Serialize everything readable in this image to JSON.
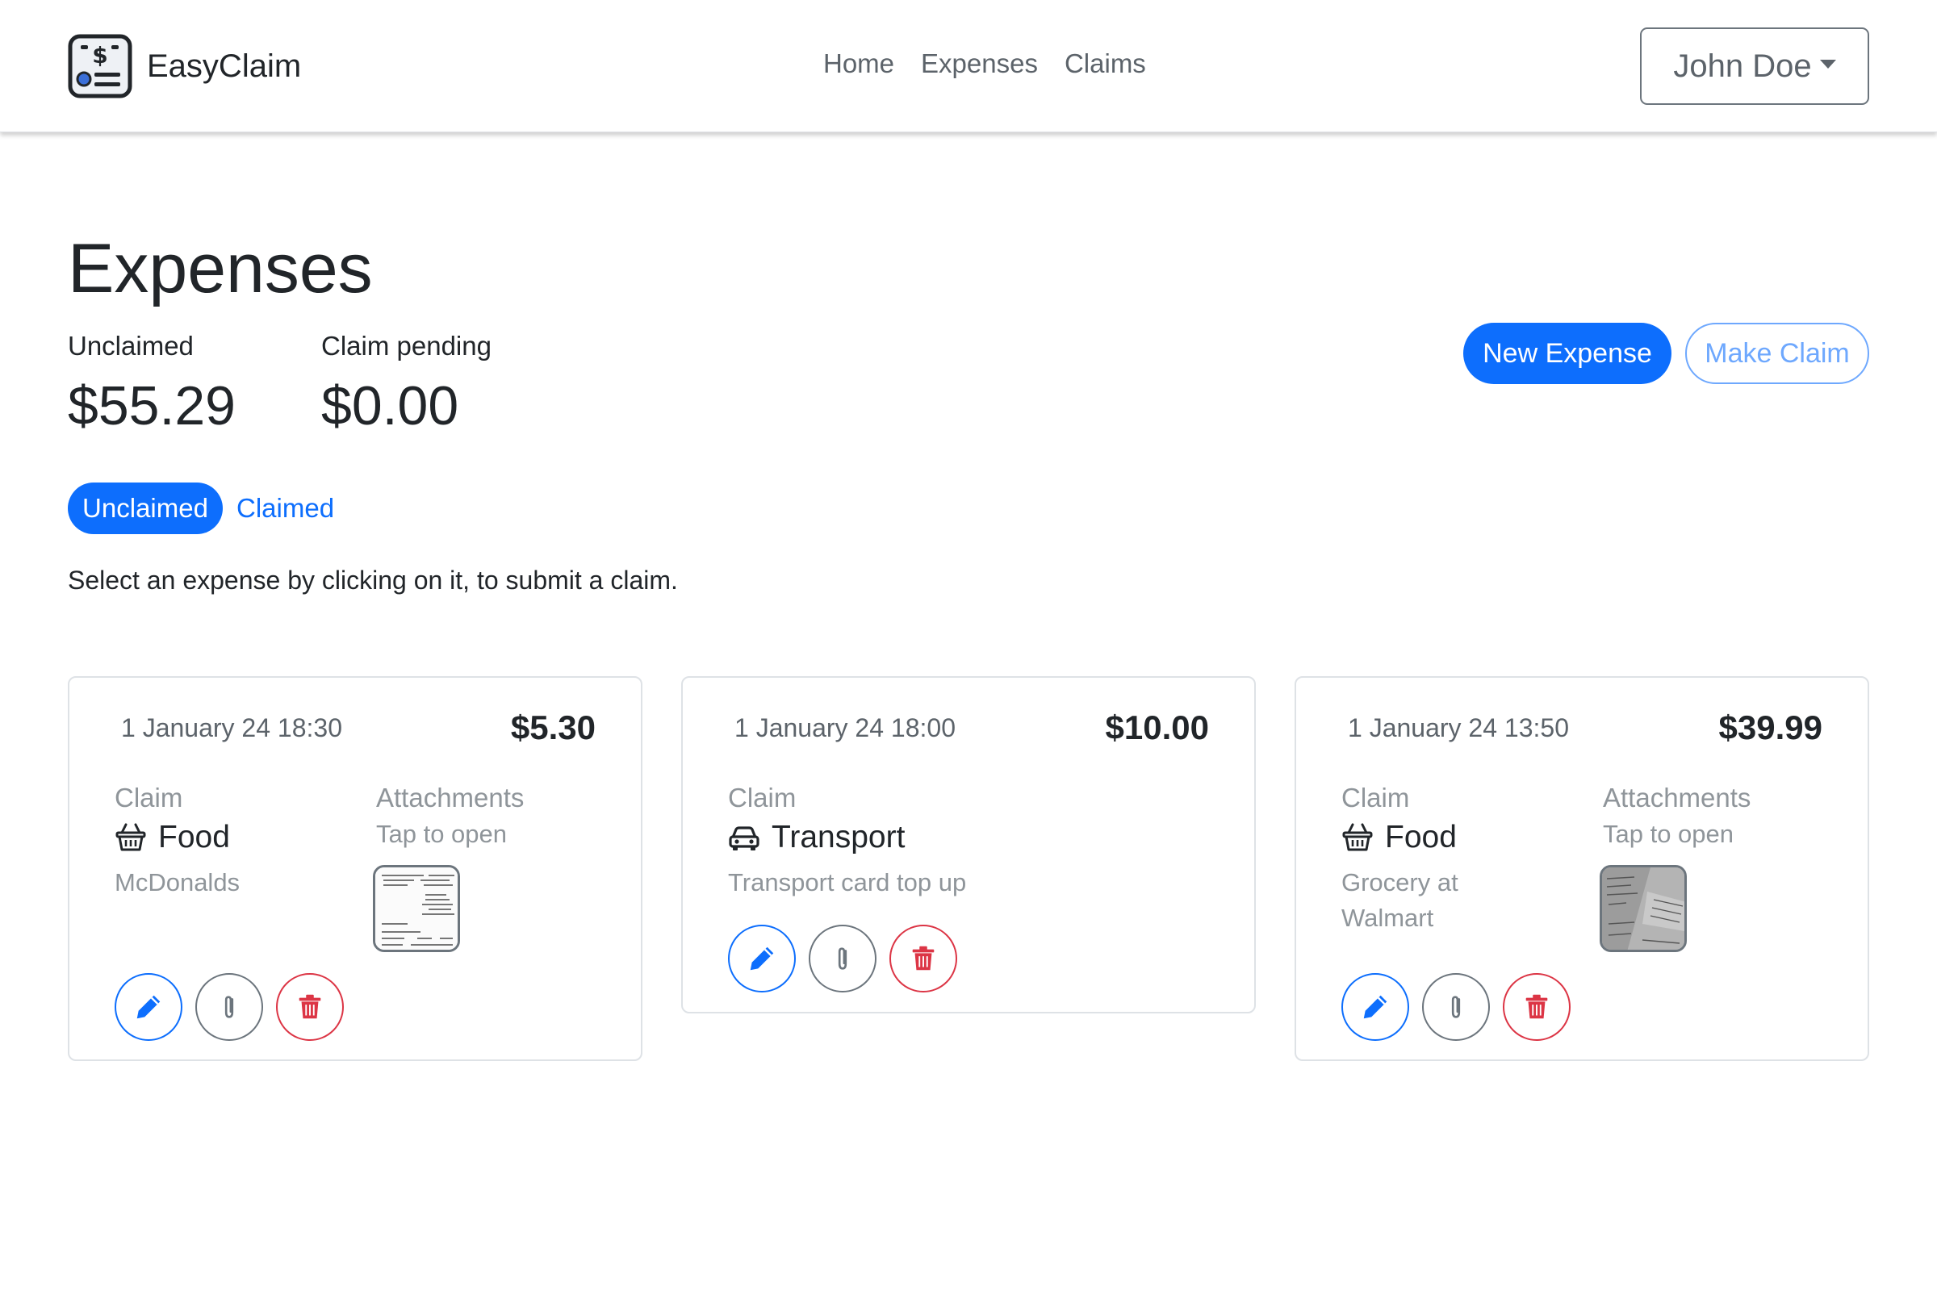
{
  "nav": {
    "brand": "EasyClaim",
    "links": [
      "Home",
      "Expenses",
      "Claims"
    ],
    "user": "John Doe"
  },
  "page": {
    "title": "Expenses",
    "unclaimed_label": "Unclaimed",
    "unclaimed_value": "$55.29",
    "pending_label": "Claim pending",
    "pending_value": "$0.00",
    "new_expense": "New Expense",
    "make_claim": "Make Claim",
    "tab_unclaimed": "Unclaimed",
    "tab_claimed": "Claimed",
    "hint": "Select an expense by clicking on it, to submit a claim."
  },
  "cards": [
    {
      "date": "1 January 24 18:30",
      "amount": "$5.30",
      "claim_label": "Claim",
      "category": "Food",
      "category_icon": "basket-icon",
      "description": "McDonalds",
      "attachments_label": "Attachments",
      "tap_label": "Tap to open"
    },
    {
      "date": "1 January 24 18:00",
      "amount": "$10.00",
      "claim_label": "Claim",
      "category": "Transport",
      "category_icon": "car-icon",
      "description": "Transport card top up"
    },
    {
      "date": "1 January 24 13:50",
      "amount": "$39.99",
      "claim_label": "Claim",
      "category": "Food",
      "category_icon": "basket-icon",
      "description": "Grocery at Walmart",
      "attachments_label": "Attachments",
      "tap_label": "Tap to open"
    }
  ],
  "colors": {
    "primary": "#0d6efd",
    "danger": "#dc3545",
    "secondary": "#6c757d"
  }
}
